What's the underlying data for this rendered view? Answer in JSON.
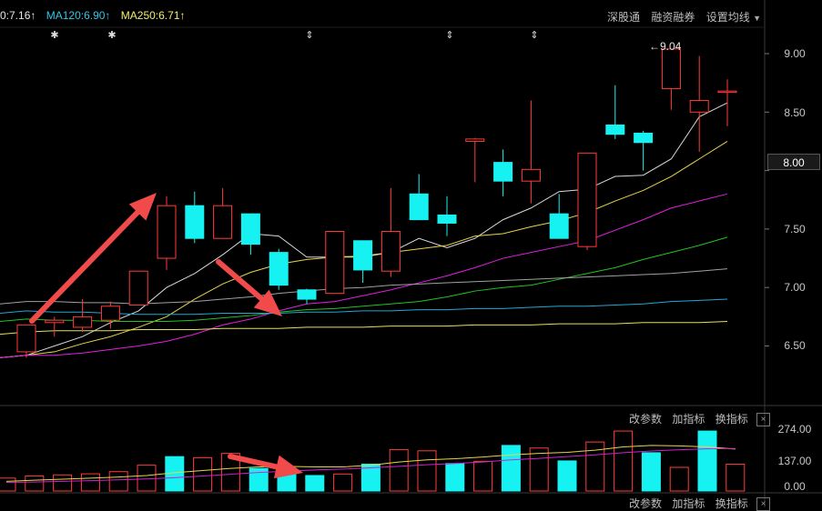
{
  "header": {
    "ma_items": [
      {
        "label": "0:7.16↑",
        "color": "#e6e6e6"
      },
      {
        "label": "MA120:6.90↑",
        "color": "#31c6e8"
      },
      {
        "label": "MA250:6.71↑",
        "color": "#f2ef70"
      }
    ],
    "tools": [
      "深股通",
      "融资融券",
      "设置均线"
    ]
  },
  "price_panel": {
    "y_labels": [
      "9.00",
      "8.50",
      "8.00",
      "7.50",
      "7.00",
      "6.50"
    ],
    "current_price": "8.00",
    "high_marker": "9.04",
    "markers": [
      "✱",
      "✱",
      "⇕",
      "⇕",
      "⇕"
    ]
  },
  "volume_panel": {
    "tools": [
      "改参数",
      "加指标",
      "换指标"
    ],
    "close_glyph": "×",
    "y_labels": [
      "274.00",
      "137.00",
      "0.00"
    ]
  },
  "bottom_panel": {
    "tools": [
      "改参数",
      "加指标",
      "换指标"
    ],
    "close_glyph": "×"
  },
  "colors": {
    "up": "#ff3b3b",
    "down": "#16f2f2",
    "ma_white": "#d8d8d8",
    "ma_yellow": "#e8d44a",
    "ma_magenta": "#e020e0",
    "ma_green": "#22c322",
    "ma_gray": "#a0a0a0",
    "ma_cyan": "#1fa7d6",
    "ma_paleyellow": "#e6e05a",
    "arrow": "#f04a4a"
  },
  "chart_data": {
    "type": "candlestick",
    "y_range": [
      6.0,
      9.3
    ],
    "candles": [
      {
        "o": 6.45,
        "h": 6.68,
        "l": 6.4,
        "c": 6.68,
        "dir": "up"
      },
      {
        "o": 6.7,
        "h": 6.75,
        "l": 6.58,
        "c": 6.72,
        "dir": "up"
      },
      {
        "o": 6.66,
        "h": 6.9,
        "l": 6.62,
        "c": 6.75,
        "dir": "up"
      },
      {
        "o": 6.72,
        "h": 6.88,
        "l": 6.65,
        "c": 6.84,
        "dir": "up"
      },
      {
        "o": 6.85,
        "h": 7.14,
        "l": 6.85,
        "c": 7.14,
        "dir": "up"
      },
      {
        "o": 7.25,
        "h": 7.78,
        "l": 7.15,
        "c": 7.7,
        "dir": "up"
      },
      {
        "o": 7.7,
        "h": 7.82,
        "l": 7.38,
        "c": 7.42,
        "dir": "down"
      },
      {
        "o": 7.42,
        "h": 7.85,
        "l": 7.42,
        "c": 7.7,
        "dir": "up"
      },
      {
        "o": 7.63,
        "h": 7.63,
        "l": 7.28,
        "c": 7.37,
        "dir": "down"
      },
      {
        "o": 7.3,
        "h": 7.33,
        "l": 6.98,
        "c": 7.02,
        "dir": "down"
      },
      {
        "o": 6.98,
        "h": 6.99,
        "l": 6.86,
        "c": 6.9,
        "dir": "down"
      },
      {
        "o": 6.95,
        "h": 7.48,
        "l": 6.95,
        "c": 7.48,
        "dir": "up"
      },
      {
        "o": 7.4,
        "h": 7.4,
        "l": 7.04,
        "c": 7.15,
        "dir": "down"
      },
      {
        "o": 7.14,
        "h": 7.85,
        "l": 7.09,
        "c": 7.48,
        "dir": "up"
      },
      {
        "o": 7.8,
        "h": 7.97,
        "l": 7.58,
        "c": 7.58,
        "dir": "down"
      },
      {
        "o": 7.62,
        "h": 7.78,
        "l": 7.44,
        "c": 7.55,
        "dir": "down"
      },
      {
        "o": 8.25,
        "h": 8.28,
        "l": 7.9,
        "c": 8.27,
        "dir": "up"
      },
      {
        "o": 8.07,
        "h": 8.18,
        "l": 7.78,
        "c": 7.91,
        "dir": "down"
      },
      {
        "o": 7.91,
        "h": 8.6,
        "l": 7.72,
        "c": 8.01,
        "dir": "up"
      },
      {
        "o": 7.63,
        "h": 7.8,
        "l": 7.42,
        "c": 7.42,
        "dir": "down"
      },
      {
        "o": 7.35,
        "h": 8.15,
        "l": 7.32,
        "c": 8.15,
        "dir": "up"
      },
      {
        "o": 8.39,
        "h": 8.73,
        "l": 8.27,
        "c": 8.31,
        "dir": "down"
      },
      {
        "o": 8.32,
        "h": 8.34,
        "l": 8.0,
        "c": 8.24,
        "dir": "down"
      },
      {
        "o": 8.7,
        "h": 9.04,
        "l": 8.52,
        "c": 9.04,
        "dir": "up"
      },
      {
        "o": 8.5,
        "h": 8.98,
        "l": 8.16,
        "c": 8.6,
        "dir": "up"
      },
      {
        "o": 8.68,
        "h": 8.78,
        "l": 8.38,
        "c": 8.68,
        "dir": "up"
      }
    ],
    "moving_averages": [
      {
        "name": "MA5",
        "values": [
          6.42,
          6.5,
          6.58,
          6.7,
          6.8,
          7.0,
          7.12,
          7.28,
          7.46,
          7.44,
          7.26,
          7.26,
          7.27,
          7.3,
          7.42,
          7.34,
          7.42,
          7.58,
          7.68,
          7.82,
          7.84,
          7.95,
          7.96,
          8.1,
          8.46,
          8.58
        ]
      },
      {
        "name": "MA10",
        "values": [
          6.42,
          6.45,
          6.52,
          6.58,
          6.66,
          6.75,
          6.9,
          7.03,
          7.13,
          7.2,
          7.24,
          7.26,
          7.26,
          7.3,
          7.33,
          7.36,
          7.44,
          7.46,
          7.52,
          7.57,
          7.64,
          7.74,
          7.83,
          7.95,
          8.1,
          8.25
        ]
      },
      {
        "name": "MA20",
        "values": [
          6.42,
          6.42,
          6.44,
          6.47,
          6.5,
          6.54,
          6.6,
          6.68,
          6.73,
          6.8,
          6.86,
          6.88,
          6.93,
          6.98,
          7.04,
          7.1,
          7.17,
          7.25,
          7.3,
          7.35,
          7.4,
          7.49,
          7.58,
          7.68,
          7.74,
          7.8
        ]
      },
      {
        "name": "MA30",
        "values": [
          6.73,
          6.72,
          6.72,
          6.71,
          6.71,
          6.71,
          6.72,
          6.74,
          6.76,
          6.79,
          6.81,
          6.82,
          6.84,
          6.86,
          6.88,
          6.92,
          6.97,
          7.0,
          7.02,
          7.07,
          7.12,
          7.17,
          7.24,
          7.3,
          7.36,
          7.43
        ]
      },
      {
        "name": "MA60",
        "values": [
          6.88,
          6.88,
          6.87,
          6.87,
          6.86,
          6.87,
          6.88,
          6.9,
          6.92,
          6.95,
          6.97,
          6.99,
          7.0,
          7.02,
          7.03,
          7.04,
          7.05,
          7.06,
          7.07,
          7.08,
          7.09,
          7.1,
          7.11,
          7.12,
          7.14,
          7.16
        ]
      },
      {
        "name": "MA120",
        "values": [
          6.8,
          6.79,
          6.79,
          6.78,
          6.77,
          6.77,
          6.77,
          6.78,
          6.78,
          6.78,
          6.79,
          6.79,
          6.8,
          6.8,
          6.81,
          6.81,
          6.82,
          6.82,
          6.83,
          6.84,
          6.84,
          6.85,
          6.86,
          6.88,
          6.89,
          6.9
        ]
      },
      {
        "name": "MA250",
        "values": [
          6.62,
          6.63,
          6.63,
          6.63,
          6.64,
          6.64,
          6.64,
          6.65,
          6.65,
          6.65,
          6.66,
          6.66,
          6.66,
          6.67,
          6.67,
          6.67,
          6.68,
          6.68,
          6.68,
          6.69,
          6.69,
          6.69,
          6.7,
          6.7,
          6.7,
          6.71
        ]
      }
    ],
    "volume": {
      "y_range": [
        0,
        330
      ],
      "values": [
        60,
        70,
        75,
        80,
        90,
        120,
        160,
        155,
        175,
        105,
        90,
        72,
        79,
        125,
        193,
        187,
        128,
        138,
        212,
        200,
        140,
        228,
        279,
        178,
        110,
        279,
        125
      ],
      "dirs": [
        "up",
        "up",
        "up",
        "up",
        "up",
        "up",
        "down",
        "up",
        "up",
        "down",
        "down",
        "down",
        "up",
        "down",
        "up",
        "up",
        "down",
        "up",
        "down",
        "up",
        "down",
        "up",
        "up",
        "down",
        "up",
        "down",
        "up"
      ],
      "ma1": [
        45,
        50,
        55,
        60,
        65,
        72,
        85,
        95,
        105,
        112,
        115,
        112,
        112,
        120,
        135,
        145,
        150,
        158,
        168,
        175,
        180,
        190,
        205,
        212,
        210,
        205,
        195
      ],
      "ma2": [
        40,
        42,
        45,
        48,
        52,
        56,
        62,
        70,
        78,
        86,
        92,
        98,
        102,
        108,
        115,
        122,
        128,
        135,
        145,
        152,
        160,
        168,
        178,
        186,
        192,
        196,
        198
      ]
    }
  }
}
